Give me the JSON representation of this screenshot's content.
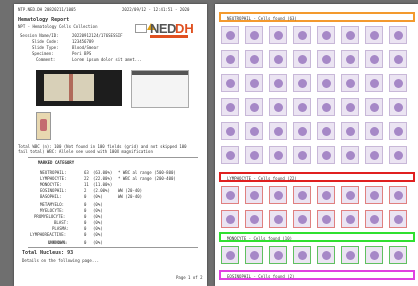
{
  "left_page": {
    "header_left": "NTP.NED.DH  20820211/1005",
    "header_right": "2022/09/12 - 12:41:51 - 2020",
    "report_title": "Hematology Report",
    "report_subtitle": "NPT - Hematology Cells Collection",
    "fields": [
      {
        "label": "Session Name/ID:",
        "value": "20220912124/176SESSIF"
      },
      {
        "label": "Slide Code:",
        "value": "123456789"
      },
      {
        "label": "Slide Type:",
        "value": "Blood/Smear"
      },
      {
        "label": "Specimen:",
        "value": "Peri BPS"
      },
      {
        "label": "Comment:",
        "value": "Lorem ipsum dolor sit amet..."
      }
    ],
    "scan_note": "Total WBC (n): 100 (Not found in 100 fields (grid) and not skipped 100 fail total) WBC: Allele see used with 100X magnification",
    "table_title": "MARKED CATEGORY",
    "cells": [
      {
        "name": "NEUTROPHIL:",
        "count": "63",
        "pct": "(63.00%)",
        "note": "* WBC al range (500-800)"
      },
      {
        "name": "LYMPHOCYTE:",
        "count": "22",
        "pct": "(22.00%)",
        "note": "* WBC al range (200-400)"
      },
      {
        "name": "MONOCYTE:",
        "count": "11",
        "pct": "(11.00%)",
        "note": ""
      },
      {
        "name": "EOSINOPHIL:",
        "count": "2",
        "pct": "(2.00%)",
        "note": "WW (20-40)"
      },
      {
        "name": "BASOPHIL:",
        "count": "0",
        "pct": "(0%)",
        "note": "WW (20-40)"
      },
      {
        "name": "METAMYELO:",
        "count": "0",
        "pct": "(0%)",
        "note": ""
      },
      {
        "name": "MYELOCYTE:",
        "count": "0",
        "pct": "(0%)",
        "note": ""
      },
      {
        "name": "PROMYELOCYTE:",
        "count": "0",
        "pct": "(0%)",
        "note": ""
      },
      {
        "name": "BLAST:",
        "count": "0",
        "pct": "(0%)",
        "note": ""
      },
      {
        "name": "PLASMA:",
        "count": "0",
        "pct": "(0%)",
        "note": ""
      },
      {
        "name": "LYMPHOREACTIVE:",
        "count": "0",
        "pct": "(0%)",
        "note": ""
      },
      {
        "name": "UNKNOWN:",
        "count": "0",
        "pct": "(0%)",
        "note": ""
      }
    ],
    "total_label": "Total Nucleus: 93",
    "footer_note": "Details on the following page...",
    "page_number": "Page 1 of 2"
  },
  "right_page": {
    "sections": [
      {
        "label": "NEUTROPHIL - Cells found (63)",
        "color": "#f39a2e",
        "rows": 6,
        "style": "plain"
      },
      {
        "label": "LYMPHOCYTE - Cells found (22)",
        "color": "#e02020",
        "rows": 2,
        "style": "red"
      },
      {
        "label": "MONOCYTE - Cells found (10)",
        "color": "#30e030",
        "rows": 1,
        "style": "green"
      },
      {
        "label": "EOSINOPHIL - Cells found (2)",
        "color": "#e040e0",
        "rows": 0,
        "style": "plain"
      }
    ]
  },
  "icons": {
    "brand_logo": "NED-DH-logo",
    "warning": "warning-triangle-icon",
    "badge": "certification-badge-icon"
  }
}
